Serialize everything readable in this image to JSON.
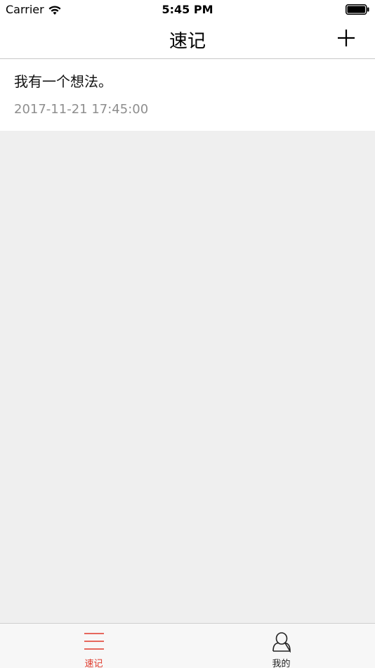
{
  "status_bar": {
    "carrier": "Carrier",
    "time": "5:45 PM"
  },
  "nav": {
    "title": "速记",
    "add_icon": "plus-icon"
  },
  "notes": [
    {
      "text": "我有一个想法。",
      "date": "2017-11-21 17:45:00"
    }
  ],
  "tabs": [
    {
      "label": "速记",
      "icon": "list-lines-icon",
      "active": true
    },
    {
      "label": "我的",
      "icon": "person-icon",
      "active": false
    }
  ],
  "colors": {
    "accent": "#e0392b",
    "background": "#efefef",
    "date_text": "#8e8e8e"
  }
}
